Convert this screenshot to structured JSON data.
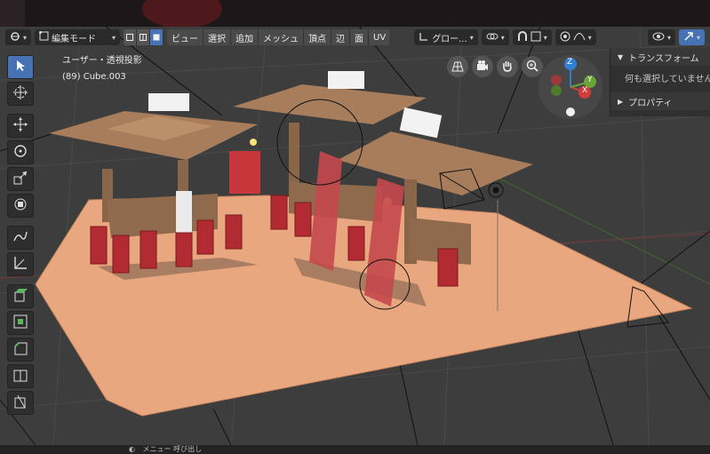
{
  "header": {
    "mode_label": "編集モード",
    "menus": [
      "ビュー",
      "選択",
      "追加",
      "メッシュ",
      "頂点",
      "辺",
      "面",
      "UV"
    ],
    "pivot_label": "グロー..."
  },
  "viewport": {
    "projection_label": "ユーザー・透視投影",
    "object_label": "(89) Cube.003"
  },
  "gizmo": {
    "z": "Z",
    "y": "Y",
    "x": "X"
  },
  "npanel": {
    "transform_header": "トランスフォーム",
    "transform_empty": "何も選択していません",
    "properties_header": "プロパティ"
  },
  "status": {
    "text": "メニュー 呼び出し"
  },
  "icons": {
    "tools": [
      "select-box-icon",
      "cursor-icon",
      "move-icon",
      "rotate-icon",
      "scale-icon",
      "transform-icon",
      "annotate-icon",
      "measure-icon",
      "extrude-icon",
      "inset-icon",
      "bevel-icon",
      "loop-cut-icon",
      "knife-icon"
    ]
  },
  "colors": {
    "accent": "#4772b3",
    "floor": "#e8a77e"
  }
}
